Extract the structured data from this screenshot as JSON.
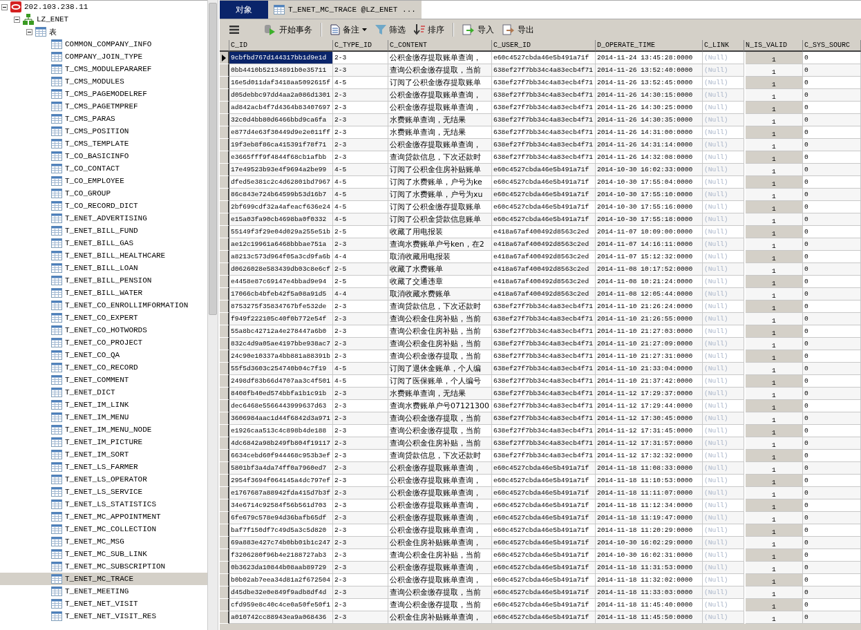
{
  "tree": [
    {
      "kind": "server",
      "label": "202.103.238.11",
      "expanded": true,
      "children": [
        {
          "kind": "database",
          "label": "LZ_ENET",
          "expanded": true,
          "children": [
            {
              "kind": "group",
              "label": "表",
              "expanded": true,
              "children": [
                {
                  "kind": "table",
                  "label": "COMMON_COMPANY_INFO",
                  "selected": false
                },
                {
                  "kind": "table",
                  "label": "COMPANY_JOIN_TYPE",
                  "selected": false
                },
                {
                  "kind": "table",
                  "label": "T_CMS_MODULEPARAREF",
                  "selected": false
                },
                {
                  "kind": "table",
                  "label": "T_CMS_MODULES",
                  "selected": false
                },
                {
                  "kind": "table",
                  "label": "T_CMS_PAGEMODELREF",
                  "selected": false
                },
                {
                  "kind": "table",
                  "label": "T_CMS_PAGETMPREF",
                  "selected": false
                },
                {
                  "kind": "table",
                  "label": "T_CMS_PARAS",
                  "selected": false
                },
                {
                  "kind": "table",
                  "label": "T_CMS_POSITION",
                  "selected": false
                },
                {
                  "kind": "table",
                  "label": "T_CMS_TEMPLATE",
                  "selected": false
                },
                {
                  "kind": "table",
                  "label": "T_CO_BASICINFO",
                  "selected": false
                },
                {
                  "kind": "table",
                  "label": "T_CO_CONTACT",
                  "selected": false
                },
                {
                  "kind": "table",
                  "label": "T_CO_EMPLOYEE",
                  "selected": false
                },
                {
                  "kind": "table",
                  "label": "T_CO_GROUP",
                  "selected": false
                },
                {
                  "kind": "table",
                  "label": "T_CO_RECORD_DICT",
                  "selected": false
                },
                {
                  "kind": "table",
                  "label": "T_ENET_ADVERTISING",
                  "selected": false
                },
                {
                  "kind": "table",
                  "label": "T_ENET_BILL_FUND",
                  "selected": false
                },
                {
                  "kind": "table",
                  "label": "T_ENET_BILL_GAS",
                  "selected": false
                },
                {
                  "kind": "table",
                  "label": "T_ENET_BILL_HEALTHCARE",
                  "selected": false
                },
                {
                  "kind": "table",
                  "label": "T_ENET_BILL_LOAN",
                  "selected": false
                },
                {
                  "kind": "table",
                  "label": "T_ENET_BILL_PENSION",
                  "selected": false
                },
                {
                  "kind": "table",
                  "label": "T_ENET_BILL_WATER",
                  "selected": false
                },
                {
                  "kind": "table",
                  "label": "T_ENET_CO_ENROLLIMFORMATION",
                  "selected": false
                },
                {
                  "kind": "table",
                  "label": "T_ENET_CO_EXPERT",
                  "selected": false
                },
                {
                  "kind": "table",
                  "label": "T_ENET_CO_HOTWORDS",
                  "selected": false
                },
                {
                  "kind": "table",
                  "label": "T_ENET_CO_PROJECT",
                  "selected": false
                },
                {
                  "kind": "table",
                  "label": "T_ENET_CO_QA",
                  "selected": false
                },
                {
                  "kind": "table",
                  "label": "T_ENET_CO_RECORD",
                  "selected": false
                },
                {
                  "kind": "table",
                  "label": "T_ENET_COMMENT",
                  "selected": false
                },
                {
                  "kind": "table",
                  "label": "T_ENET_DICT",
                  "selected": false
                },
                {
                  "kind": "table",
                  "label": "T_ENET_IM_LINK",
                  "selected": false
                },
                {
                  "kind": "table",
                  "label": "T_ENET_IM_MENU",
                  "selected": false
                },
                {
                  "kind": "table",
                  "label": "T_ENET_IM_MENU_NODE",
                  "selected": false
                },
                {
                  "kind": "table",
                  "label": "T_ENET_IM_PICTURE",
                  "selected": false
                },
                {
                  "kind": "table",
                  "label": "T_ENET_IM_SORT",
                  "selected": false
                },
                {
                  "kind": "table",
                  "label": "T_ENET_LS_FARMER",
                  "selected": false
                },
                {
                  "kind": "table",
                  "label": "T_ENET_LS_OPERATOR",
                  "selected": false
                },
                {
                  "kind": "table",
                  "label": "T_ENET_LS_SERVICE",
                  "selected": false
                },
                {
                  "kind": "table",
                  "label": "T_ENET_LS_STATISTICS",
                  "selected": false
                },
                {
                  "kind": "table",
                  "label": "T_ENET_MC_APPOINTMENT",
                  "selected": false
                },
                {
                  "kind": "table",
                  "label": "T_ENET_MC_COLLECTION",
                  "selected": false
                },
                {
                  "kind": "table",
                  "label": "T_ENET_MC_MSG",
                  "selected": false
                },
                {
                  "kind": "table",
                  "label": "T_ENET_MC_SUB_LINK",
                  "selected": false
                },
                {
                  "kind": "table",
                  "label": "T_ENET_MC_SUBSCRIPTION",
                  "selected": false
                },
                {
                  "kind": "table",
                  "label": "T_ENET_MC_TRACE",
                  "selected": true
                },
                {
                  "kind": "table",
                  "label": "T_ENET_MEETING",
                  "selected": false
                },
                {
                  "kind": "table",
                  "label": "T_ENET_NET_VISIT",
                  "selected": false
                },
                {
                  "kind": "table",
                  "label": "T_ENET_NET_VISIT_RES",
                  "selected": false
                }
              ]
            }
          ]
        }
      ]
    }
  ],
  "tabs": [
    {
      "label": "对象",
      "selected": true,
      "kind": "plain"
    },
    {
      "label": "T_ENET_MC_TRACE @LZ_ENET ...",
      "selected": false,
      "kind": "table"
    }
  ],
  "toolbar": [
    {
      "kind": "menu"
    },
    {
      "kind": "transaction",
      "label": "开始事务"
    },
    {
      "kind": "separator"
    },
    {
      "kind": "note",
      "label": "备注",
      "dropdown": true
    },
    {
      "kind": "filter",
      "label": "筛选"
    },
    {
      "kind": "sort",
      "label": "排序"
    },
    {
      "kind": "separator"
    },
    {
      "kind": "import",
      "label": "导入"
    },
    {
      "kind": "export",
      "label": "导出"
    }
  ],
  "table": {
    "columns": [
      {
        "label": "C_ID",
        "kind": "text"
      },
      {
        "label": "C_TYPE_ID",
        "kind": "text"
      },
      {
        "label": "C_CONTENT",
        "kind": "text"
      },
      {
        "label": "C_USER_ID",
        "kind": "text"
      },
      {
        "label": "D_OPERATE_TIME",
        "kind": "text"
      },
      {
        "label": "C_LINK",
        "kind": "null"
      },
      {
        "label": "N_IS_VALID",
        "kind": "number"
      },
      {
        "label": "C_SYS_SOURC",
        "kind": "text"
      }
    ],
    "rows": [
      {
        "selected": true,
        "cells": [
          "9cbfbd767d144317bb1d9e1d",
          "2-3",
          "公积金缴存提取账单查询，",
          "e60c4527cbda46e5b491a71f",
          "2014-11-24 13:45:28:0000",
          "(Null)",
          "1",
          "0"
        ]
      },
      {
        "selected": false,
        "cells": [
          "0bb4410b52134891b0e35711",
          "2-3",
          "查询公积金缴存提取，当前",
          "638ef27f7bb34c4a83ecb4f71",
          "2014-11-26 13:52:40:0000",
          "(Null)",
          "1",
          "0"
        ]
      },
      {
        "selected": false,
        "cells": [
          "16e5d011daf3418aa5092615f",
          "4-5",
          "订阅了公积金缴存提取账单",
          "638ef27f7bb34c4a83ecb4f71",
          "2014-11-26 13:52:45:0000",
          "(Null)",
          "1",
          "0"
        ]
      },
      {
        "selected": false,
        "cells": [
          "d05debbc97dd4aa2a086d1301",
          "2-3",
          "公积金缴存提取账单查询，",
          "638ef27f7bb34c4a83ecb4f71",
          "2014-11-26 14:30:15:0000",
          "(Null)",
          "1",
          "0"
        ]
      },
      {
        "selected": false,
        "cells": [
          "ad842acb4f7d4364b83407697",
          "2-3",
          "公积金缴存提取账单查询，",
          "638ef27f7bb34c4a83ecb4f71",
          "2014-11-26 14:30:25:0000",
          "(Null)",
          "1",
          "0"
        ]
      },
      {
        "selected": false,
        "cells": [
          "32c0d4bb80d6466bbd9ca6fa",
          "2-3",
          "水费账单查询，无结果",
          "638ef27f7bb34c4a83ecb4f71",
          "2014-11-26 14:30:35:0000",
          "(Null)",
          "1",
          "0"
        ]
      },
      {
        "selected": false,
        "cells": [
          "e877d4e63f30449d9e2e011ff",
          "2-3",
          "水费账单查询，无结果",
          "638ef27f7bb34c4a83ecb4f71",
          "2014-11-26 14:31:00:0000",
          "(Null)",
          "1",
          "0"
        ]
      },
      {
        "selected": false,
        "cells": [
          "19f3eb8f86ca415391f78f71",
          "2-3",
          "公积金缴存提取账单查询，",
          "638ef27f7bb34c4a83ecb4f71",
          "2014-11-26 14:31:14:0000",
          "(Null)",
          "1",
          "0"
        ]
      },
      {
        "selected": false,
        "cells": [
          "e3665fff9f4844f68cb1afbb",
          "2-3",
          "查询贷款信息，下次还款时",
          "638ef27f7bb34c4a83ecb4f71",
          "2014-11-26 14:32:08:0000",
          "(Null)",
          "1",
          "0"
        ]
      },
      {
        "selected": false,
        "cells": [
          "17e49523b93e4f9694a2be99",
          "4-5",
          "订阅了公积金住房补贴账单",
          "e60c4527cbda46e5b491a71f",
          "2014-10-30 16:02:33:0000",
          "(Null)",
          "1",
          "0"
        ]
      },
      {
        "selected": false,
        "cells": [
          "dfed5e381c2c4d62801bd7967",
          "4-5",
          "订阅了水费账单，户号为ke",
          "e60c4527cbda46e5b491a71f",
          "2014-10-30 17:55:04:0000",
          "(Null)",
          "1",
          "0"
        ]
      },
      {
        "selected": false,
        "cells": [
          "86c843e724b64599b53d16b7",
          "4-5",
          "订阅了水费账单，户号为xu",
          "e60c4527cbda46e5b491a71f",
          "2014-10-30 17:55:10:0000",
          "(Null)",
          "1",
          "0"
        ]
      },
      {
        "selected": false,
        "cells": [
          "2bf699cdf32a4afeacf636e24",
          "4-5",
          "订阅了公积金缴存提取账单",
          "e60c4527cbda46e5b491a71f",
          "2014-10-30 17:55:16:0000",
          "(Null)",
          "1",
          "0"
        ]
      },
      {
        "selected": false,
        "cells": [
          "e15a03fa90cb4698ba0f0332",
          "4-5",
          "订阅了公积金贷款信息账单",
          "e60c4527cbda46e5b491a71f",
          "2014-10-30 17:55:18:0000",
          "(Null)",
          "1",
          "0"
        ]
      },
      {
        "selected": false,
        "cells": [
          "55149f3f29e04d029a255e51b",
          "2-5",
          "收藏了用电报装",
          "e418a67af400492d8563c2ed",
          "2014-11-07 10:09:00:0000",
          "(Null)",
          "1",
          "0"
        ]
      },
      {
        "selected": false,
        "cells": [
          "ae12c19961a6468bbbae751a",
          "2-3",
          "查询水费账单户号ken，在2",
          "e418a67af400492d8563c2ed",
          "2014-11-07 14:16:11:0000",
          "(Null)",
          "1",
          "0"
        ]
      },
      {
        "selected": false,
        "cells": [
          "a8213c573d964f05a3cd9fa6b",
          "4-4",
          "取消收藏用电报装",
          "e418a67af400492d8563c2ed",
          "2014-11-07 15:12:32:0000",
          "(Null)",
          "1",
          "0"
        ]
      },
      {
        "selected": false,
        "cells": [
          "d0626028e583439db03c8e6cf",
          "2-5",
          "收藏了水费账单",
          "e418a67af400492d8563c2ed",
          "2014-11-08 10:17:52:0000",
          "(Null)",
          "1",
          "0"
        ]
      },
      {
        "selected": false,
        "cells": [
          "e4458e87c69147e4bbad9e94",
          "2-5",
          "收藏了交通违章",
          "e418a67af400492d8563c2ed",
          "2014-11-08 10:21:24:0000",
          "(Null)",
          "1",
          "0"
        ]
      },
      {
        "selected": false,
        "cells": [
          "17066cb4bfeb42f5a08a91d5",
          "4-4",
          "取消收藏水费账单",
          "e418a67af400492d8563c2ed",
          "2014-11-08 12:05:44:0000",
          "(Null)",
          "1",
          "0"
        ]
      },
      {
        "selected": false,
        "cells": [
          "8753275f35834767bfe532de",
          "2-3",
          "查询贷款信息，下次还款时",
          "638ef27f7bb34c4a83ecb4f71",
          "2014-11-10 21:26:24:0000",
          "(Null)",
          "1",
          "0"
        ]
      },
      {
        "selected": false,
        "cells": [
          "f949f222105c40f0b772e54f",
          "2-3",
          "查询公积金住房补贴，当前",
          "638ef27f7bb34c4a83ecb4f71",
          "2014-11-10 21:26:55:0000",
          "(Null)",
          "1",
          "0"
        ]
      },
      {
        "selected": false,
        "cells": [
          "55a8bc42712a4e278447a6b0",
          "2-3",
          "查询公积金住房补贴，当前",
          "638ef27f7bb34c4a83ecb4f71",
          "2014-11-10 21:27:03:0000",
          "(Null)",
          "1",
          "0"
        ]
      },
      {
        "selected": false,
        "cells": [
          "832c4d9a05ae4197bbe938ac7",
          "2-3",
          "查询公积金住房补贴，当前",
          "638ef27f7bb34c4a83ecb4f71",
          "2014-11-10 21:27:09:0000",
          "(Null)",
          "1",
          "0"
        ]
      },
      {
        "selected": false,
        "cells": [
          "24c90e10337a4bb881a88391b",
          "2-3",
          "查询公积金缴存提取，当前",
          "638ef27f7bb34c4a83ecb4f71",
          "2014-11-10 21:27:31:0000",
          "(Null)",
          "1",
          "0"
        ]
      },
      {
        "selected": false,
        "cells": [
          "55f5d3603c254740b04c7f19",
          "4-5",
          "订阅了退休金账单，个人编",
          "638ef27f7bb34c4a83ecb4f71",
          "2014-11-10 21:33:04:0000",
          "(Null)",
          "1",
          "0"
        ]
      },
      {
        "selected": false,
        "cells": [
          "2498df83b66d4707aa3c4f501",
          "4-5",
          "订阅了医保账单，个人编号",
          "638ef27f7bb34c4a83ecb4f71",
          "2014-11-10 21:37:42:0000",
          "(Null)",
          "1",
          "0"
        ]
      },
      {
        "selected": false,
        "cells": [
          "8408fb40ed574bbfa1b1c91b",
          "2-3",
          "水费账单查询，无结果",
          "638ef27f7bb34c4a83ecb4f71",
          "2014-11-12 17:29:37:0000",
          "(Null)",
          "1",
          "0"
        ]
      },
      {
        "selected": false,
        "cells": [
          "dec6468e5566443999637d63",
          "2-3",
          "查询水费账单户号07121300",
          "638ef27f7bb34c4a83ecb4f71",
          "2014-11-12 17:29:44:0000",
          "(Null)",
          "1",
          "0"
        ]
      },
      {
        "selected": false,
        "cells": [
          "3606984aac1d44f6842d3a971",
          "2-3",
          "查询公积金缴存提取，当前",
          "638ef27f7bb34c4a83ecb4f71",
          "2014-11-12 17:30:45:0000",
          "(Null)",
          "1",
          "0"
        ]
      },
      {
        "selected": false,
        "cells": [
          "e1926caa513c4c898b4de188",
          "2-3",
          "查询公积金缴存提取，当前",
          "638ef27f7bb34c4a83ecb4f71",
          "2014-11-12 17:31:45:0000",
          "(Null)",
          "1",
          "0"
        ]
      },
      {
        "selected": false,
        "cells": [
          "4dc6842a98b249fb804f19117",
          "2-3",
          "查询公积金住房补贴，当前",
          "638ef27f7bb34c4a83ecb4f71",
          "2014-11-12 17:31:57:0000",
          "(Null)",
          "1",
          "0"
        ]
      },
      {
        "selected": false,
        "cells": [
          "6634cebd60f944468c953b3ef",
          "2-3",
          "查询贷款信息，下次还款时",
          "638ef27f7bb34c4a83ecb4f71",
          "2014-11-12 17:32:32:0000",
          "(Null)",
          "1",
          "0"
        ]
      },
      {
        "selected": false,
        "cells": [
          "5801bf3a4da74ff0a7960ed7",
          "2-3",
          "公积金缴存提取账单查询，",
          "e60c4527cbda46e5b491a71f",
          "2014-11-18 11:08:33:0000",
          "(Null)",
          "1",
          "0"
        ]
      },
      {
        "selected": false,
        "cells": [
          "2954f3694f064145a4dc797ef",
          "2-3",
          "公积金缴存提取账单查询，",
          "e60c4527cbda46e5b491a71f",
          "2014-11-18 11:10:53:0000",
          "(Null)",
          "1",
          "0"
        ]
      },
      {
        "selected": false,
        "cells": [
          "e1767687a88942fda415d7b3f",
          "2-3",
          "公积金缴存提取账单查询，",
          "e60c4527cbda46e5b491a71f",
          "2014-11-18 11:11:07:0000",
          "(Null)",
          "1",
          "0"
        ]
      },
      {
        "selected": false,
        "cells": [
          "34e6714c92584f56b561d703",
          "2-3",
          "公积金缴存提取账单查询，",
          "e60c4527cbda46e5b491a71f",
          "2014-11-18 11:12:34:0000",
          "(Null)",
          "1",
          "0"
        ]
      },
      {
        "selected": false,
        "cells": [
          "6fe679c578e94d36bafb65df",
          "2-3",
          "公积金缴存提取账单查询，",
          "e60c4527cbda46e5b491a71f",
          "2014-11-18 11:19:47:0000",
          "(Null)",
          "1",
          "0"
        ]
      },
      {
        "selected": false,
        "cells": [
          "baf7f150df7c49d5a3c5d820",
          "2-3",
          "公积金缴存提取账单查询，",
          "e60c4527cbda46e5b491a71f",
          "2014-11-18 11:20:29:0000",
          "(Null)",
          "1",
          "0"
        ]
      },
      {
        "selected": false,
        "cells": [
          "69a883e427c74b0bb01b1c247",
          "2-3",
          "公积金住房补贴账单查询，",
          "e60c4527cbda46e5b491a71f",
          "2014-10-30 16:02:29:0000",
          "(Null)",
          "1",
          "0"
        ]
      },
      {
        "selected": false,
        "cells": [
          "f3206280f96b4e2188727ab3",
          "2-3",
          "查询公积金住房补贴，当前",
          "e60c4527cbda46e5b491a71f",
          "2014-10-30 16:02:31:0000",
          "(Null)",
          "1",
          "0"
        ]
      },
      {
        "selected": false,
        "cells": [
          "0b3623da10844b08aab89729",
          "2-3",
          "公积金缴存提取账单查询，",
          "e60c4527cbda46e5b491a71f",
          "2014-11-18 11:31:53:0000",
          "(Null)",
          "1",
          "0"
        ]
      },
      {
        "selected": false,
        "cells": [
          "b0b02ab7eea34d81a2f672504",
          "2-3",
          "公积金缴存提取账单查询，",
          "e60c4527cbda46e5b491a71f",
          "2014-11-18 11:32:02:0000",
          "(Null)",
          "1",
          "0"
        ]
      },
      {
        "selected": false,
        "cells": [
          "d45dbe32e0e849f9adb8df4d",
          "2-3",
          "查询公积金缴存提取，当前",
          "e60c4527cbda46e5b491a71f",
          "2014-11-18 11:33:03:0000",
          "(Null)",
          "1",
          "0"
        ]
      },
      {
        "selected": false,
        "cells": [
          "cfd959e8c40c4ce0a50fe50f1",
          "2-3",
          "查询公积金缴存提取，当前",
          "e60c4527cbda46e5b491a71f",
          "2014-11-18 11:45:40:0000",
          "(Null)",
          "1",
          "0"
        ]
      },
      {
        "selected": false,
        "cells": [
          "a010742cc88943ea9a068436",
          "2-3",
          "公积金住房补贴账单查询，",
          "e60c4527cbda46e5b491a71f",
          "2014-11-18 11:45:50:0000",
          "(Null)",
          "1",
          "0"
        ]
      }
    ]
  }
}
